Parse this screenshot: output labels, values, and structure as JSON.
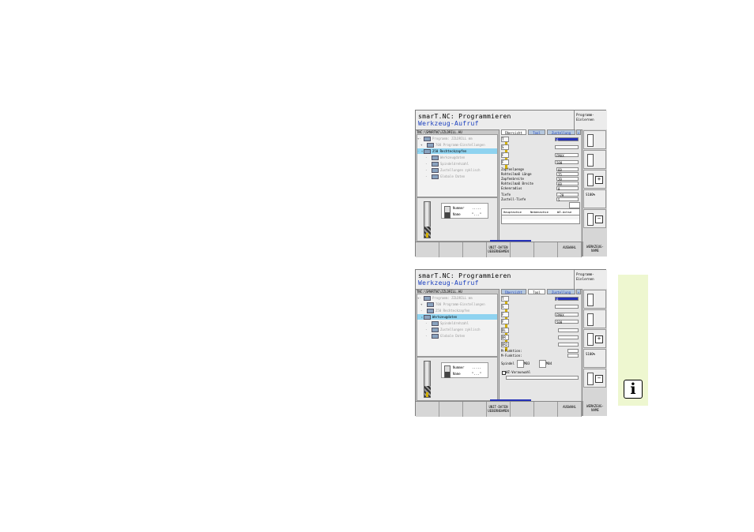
{
  "app": {
    "title_line1": "smarT.NC: Programmieren",
    "title_line2": "Werkzeug-Aufruf",
    "mode_line1": "Programm-",
    "mode_line2": "Einlernen"
  },
  "screens": [
    {
      "path": "TNC:\\SMARTNC\\ZZLDRILL.HU",
      "tree": [
        {
          "label": "Programm: ZZLDRILL mm",
          "state": "dim"
        },
        {
          "label": "700 Programm-Einstellungen",
          "state": "dim"
        },
        {
          "label": "250 Rechteckzapfen",
          "state": "selected"
        },
        {
          "label": "Werkzeugdaten",
          "state": "dim"
        },
        {
          "label": "Spindeldrehzahl",
          "state": "dim"
        },
        {
          "label": "Zustellungen zyklisch",
          "state": "dim"
        },
        {
          "label": "Globale Daten",
          "state": "dim"
        }
      ],
      "preview": {
        "number_label": "Nummer",
        "number_value": ".....",
        "name_label": "Name",
        "name_value": "\"...\""
      },
      "tabs": [
        "Übersicht",
        "Tool",
        "Zustellung"
      ],
      "active_tab": 0,
      "tool_rows": [
        {
          "sym": "T",
          "value": "6"
        },
        {
          "sym": "S",
          "value": ""
        },
        {
          "sym": "F",
          "value": "FMAX"
        },
        {
          "sym": "F",
          "value": "500"
        }
      ],
      "params": [
        {
          "label": "Zapfenlaenge",
          "value": "60"
        },
        {
          "label": "Rohteilmaß Länge",
          "value": "75"
        },
        {
          "label": "Zapfenbreite",
          "value": "20"
        },
        {
          "label": "Rohteilmaß Breite",
          "value": "60"
        },
        {
          "label": "Eckenradius",
          "value": "0"
        },
        {
          "label": "Tiefe",
          "value": "-20"
        },
        {
          "label": "Zustell-Tiefe",
          "value": "5"
        }
      ],
      "columns": [
        "Hauptachse",
        "Nebenachse",
        "WZ-Achse"
      ],
      "softkeys": [
        "",
        "",
        "",
        "UNIT-DATEN UEBERNEHMEN",
        "",
        "",
        "AUSWAHL"
      ],
      "side_button": "WERKZEUG-NAME",
      "side_labels": [
        "",
        "",
        "",
        "",
        "S100%",
        ""
      ]
    },
    {
      "path": "TNC:\\SMARTNC\\ZZLDRILL.HU",
      "tree": [
        {
          "label": "Programm: ZZLDRILL mm",
          "state": "dim"
        },
        {
          "label": "700 Programm-Einstellungen",
          "state": "dim"
        },
        {
          "label": "250 Rechteckzapfen",
          "state": "dim"
        },
        {
          "label": "Werkzeugdaten",
          "state": "selected"
        },
        {
          "label": "Spindeldrehzahl",
          "state": "dim"
        },
        {
          "label": "Zustellungen zyklisch",
          "state": "dim"
        },
        {
          "label": "Globale Daten",
          "state": "dim"
        }
      ],
      "preview": {
        "number_label": "Nummer",
        "number_value": ".....",
        "name_label": "Name",
        "name_value": "\"...\""
      },
      "tabs": [
        "Übersicht",
        "Tool",
        "Zustellung"
      ],
      "active_tab": 1,
      "tool_rows": [
        {
          "sym": "T",
          "value": "6"
        },
        {
          "sym": "S",
          "value": ""
        },
        {
          "sym": "F",
          "value": "FMAX"
        },
        {
          "sym": "F",
          "value": "500"
        }
      ],
      "extra_rows": [
        {
          "sym": "DL",
          "value": ""
        },
        {
          "sym": "DR",
          "value": ""
        },
        {
          "sym": "DR2",
          "value": ""
        }
      ],
      "mfunc": [
        "M-Funktion:",
        "M-Funktion:"
      ],
      "spindle": {
        "label": "Spindel",
        "opt1": "M03",
        "opt2": "M04"
      },
      "checkbox": "WZ-Vorauswahl",
      "softkeys": [
        "",
        "",
        "",
        "UNIT-DATEN UEBERNEHMEN",
        "",
        "",
        "AUSWAHL"
      ],
      "side_button": "WERKZEUG-NAME",
      "side_labels": [
        "",
        "",
        "",
        "",
        "S100%",
        ""
      ]
    }
  ],
  "info_panel": {
    "icon": "info-icon",
    "glyph": "i",
    "color": "#eef7d0"
  }
}
